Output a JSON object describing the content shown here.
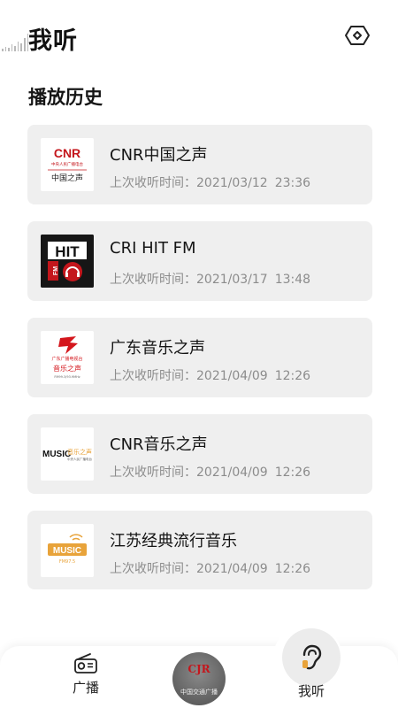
{
  "header": {
    "title": "我听",
    "settings_icon": "hexagon-settings-icon"
  },
  "history": {
    "title": "播放历史",
    "time_prefix": "上次收听时间：",
    "items": [
      {
        "name": "CNR中国之声",
        "date": "2021/03/12",
        "time": "23:36",
        "logo": {
          "main": "CNR",
          "sub": "中央人民广播电台",
          "caption": "中国之声"
        }
      },
      {
        "name": "CRI HIT FM",
        "date": "2021/03/17",
        "time": "13:48",
        "logo": {
          "main": "HIT",
          "sub": "FM"
        }
      },
      {
        "name": "广东音乐之声",
        "date": "2021/04/09",
        "time": "12:26",
        "logo": {
          "main": "广东广播电视台",
          "caption": "音乐之声",
          "sub": "FM99.3/93.9MHz"
        }
      },
      {
        "name": "CNR音乐之声",
        "date": "2021/04/09",
        "time": "12:26",
        "logo": {
          "main": "MUSIC",
          "caption": "音乐之声",
          "sub": "中央人民广播电台"
        }
      },
      {
        "name": "江苏经典流行音乐",
        "date": "2021/04/09",
        "time": "12:26",
        "logo": {
          "main": "MUSIC",
          "sub": "FM97.5"
        }
      }
    ]
  },
  "bottom_nav": {
    "broadcast_label": "广播",
    "mine_label": "我听",
    "now_playing_logo": "CJR",
    "now_playing_caption": "中国交通广播"
  },
  "colors": {
    "card_bg": "#efefef",
    "accent_red": "#c4161c",
    "accent_orange": "#e8a33a",
    "muted_text": "#8c8c8c"
  }
}
